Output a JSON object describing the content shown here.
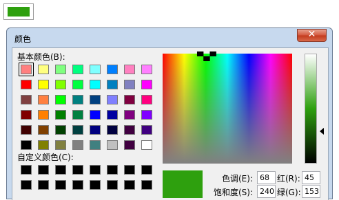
{
  "top_swatch": {
    "color": "#2ea00e"
  },
  "dialog": {
    "title": "颜色",
    "close_symbol": "✕",
    "basic_colors_label": "基本颜色(B):",
    "custom_colors_label": "自定义颜色(C):",
    "basic_colors": [
      "#ff8080",
      "#ffff80",
      "#80ff80",
      "#00ff80",
      "#80ffff",
      "#0080ff",
      "#ff80c0",
      "#ff80ff",
      "#ff0000",
      "#ffff00",
      "#80ff00",
      "#00ff40",
      "#00ffff",
      "#0080c0",
      "#8080c0",
      "#ff00ff",
      "#804040",
      "#ff8040",
      "#00ff00",
      "#008080",
      "#004080",
      "#8080ff",
      "#800040",
      "#ff0080",
      "#800000",
      "#ff8000",
      "#008000",
      "#008040",
      "#0000ff",
      "#0000a0",
      "#800080",
      "#8000ff",
      "#400000",
      "#804000",
      "#004000",
      "#004040",
      "#000080",
      "#000040",
      "#400040",
      "#400080",
      "#000000",
      "#808000",
      "#808040",
      "#808080",
      "#408080",
      "#c0c0c0",
      "#400040",
      "#ffffff"
    ],
    "custom_colors": [
      "#000000",
      "#000000",
      "#000000",
      "#000000",
      "#000000",
      "#000000",
      "#000000",
      "#000000",
      "#000000",
      "#000000",
      "#000000",
      "#000000",
      "#000000",
      "#000000",
      "#000000",
      "#000000"
    ],
    "selected_color": "#2ea00e",
    "hue_label": "色调(E):",
    "hue_value": "68",
    "sat_label": "饱和度(S):",
    "sat_value": "240",
    "red_label": "红(R):",
    "red_value": "45",
    "green_label": "绿(G):",
    "green_value": "153",
    "crosshair": "▀▄▀"
  }
}
